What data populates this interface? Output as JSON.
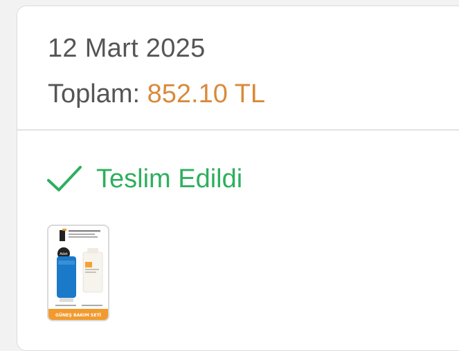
{
  "order": {
    "date": "12 Mart 2025",
    "total_label": "Toplam:",
    "total_amount": "852.10 TL",
    "status": "Teslim Edildi",
    "status_icon": "check-icon",
    "product_image": {
      "banner_text": "GÜNEŞ BAKIM SETİ",
      "badge_text": "Adet"
    }
  },
  "colors": {
    "status_green": "#2eaf5e",
    "amount_orange": "#d98a3a",
    "text_gray": "#555555"
  }
}
